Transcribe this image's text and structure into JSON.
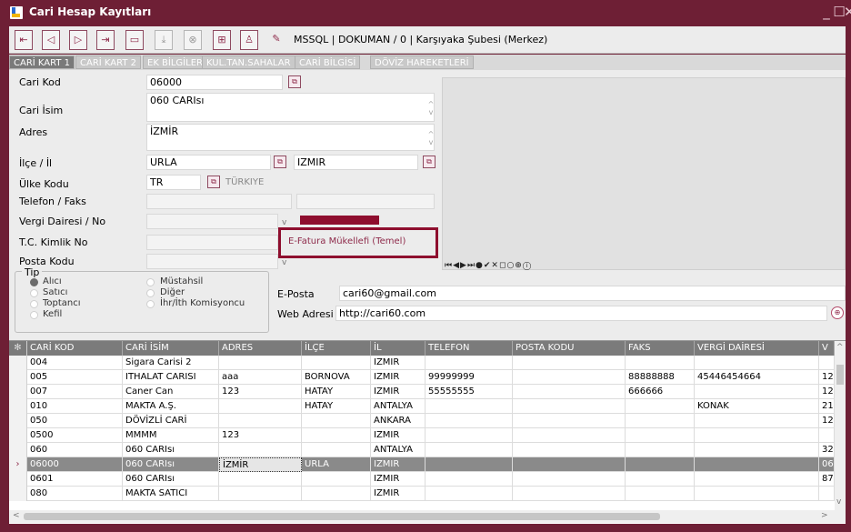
{
  "window": {
    "title": "Cari Hesap Kayıtları"
  },
  "toolbar": {
    "buttons": [
      "first-record",
      "prev-record",
      "next-record",
      "last-record",
      "new-record",
      "save",
      "cancel",
      "add",
      "user",
      "edit"
    ],
    "db_info": "MSSQL | DOKUMAN / 0 | Karşıyaka Şubesi (Merkez)"
  },
  "tabs": [
    "CARİ KART 1",
    "CARİ KART 2",
    "EK BİLGİLER",
    "KUL.TAN.SAHALAR",
    "CARİ BİLGİSİ",
    "DÖVİZ HAREKETLERİ"
  ],
  "form": {
    "cari_kod_label": "Cari Kod",
    "cari_kod": "06000",
    "cari_isim_label": "Cari İsim",
    "cari_isim": "060 CARIsı",
    "adres_label": "Adres",
    "adres": "İZMİR",
    "ilce_il_label": "İlçe / İl",
    "ilce": "URLA",
    "il": "IZMIR",
    "ulke_label": "Ülke Kodu",
    "ulke_kodu": "TR",
    "ulke_adi": "TÜRKIYE",
    "telefon_label": "Telefon / Faks",
    "vergi_label": "Vergi Dairesi / No",
    "tc_label": "T.C. Kimlik No",
    "posta_label": "Posta Kodu",
    "efatura_option": "E-Fatura Mükellefi (Temel)"
  },
  "tip": {
    "title": "Tip",
    "options_left": [
      "Alıcı",
      "Satıcı",
      "Toptancı",
      "Kefil"
    ],
    "options_right": [
      "Müstahsil",
      "Diğer",
      "İhr/İth Komisyoncu"
    ],
    "selected": "Alıcı"
  },
  "contact": {
    "email_label": "E-Posta",
    "email": "cari60@gmail.com",
    "web_label": "Web Adresi",
    "web": "http://cari60.com"
  },
  "grid": {
    "columns": [
      "CARİ KOD",
      "CARİ İSİM",
      "ADRES",
      "İLÇE",
      "İL",
      "TELEFON",
      "POSTA KODU",
      "FAKS",
      "VERGİ DAİRESİ",
      "V"
    ],
    "rows": [
      [
        "004",
        "Sigara Carisi 2",
        "",
        "",
        "IZMIR",
        "",
        "",
        "",
        "",
        ""
      ],
      [
        "005",
        "ITHALAT CARISI",
        "aaa",
        "BORNOVA",
        "IZMIR",
        "99999999",
        "",
        "88888888",
        "45446454664",
        "12"
      ],
      [
        "007",
        "Caner Can",
        "123",
        "HATAY",
        "IZMIR",
        "55555555",
        "",
        "666666",
        "",
        "12"
      ],
      [
        "010",
        "MAKTA A.Ş.",
        "",
        "HATAY",
        "ANTALYA",
        "",
        "",
        "",
        "KONAK",
        "21"
      ],
      [
        "050",
        "DÖVİZLİ CARİ",
        "",
        "",
        "ANKARA",
        "",
        "",
        "",
        "",
        "12"
      ],
      [
        "0500",
        "MMMM",
        "123",
        "",
        "IZMIR",
        "",
        "",
        "",
        "",
        ""
      ],
      [
        "060",
        "060 CARIsı",
        "",
        "",
        "ANTALYA",
        "",
        "",
        "",
        "",
        "32"
      ],
      [
        "06000",
        "060 CARIsı",
        "İZMİR",
        "URLA",
        "IZMIR",
        "",
        "",
        "",
        "",
        "06"
      ],
      [
        "0601",
        "060 CARIsı",
        "",
        "",
        "IZMIR",
        "",
        "",
        "",
        "",
        "87"
      ],
      [
        "080",
        "MAKTA SATICI",
        "",
        "",
        "IZMIR",
        "",
        "",
        "",
        "",
        ""
      ]
    ],
    "selected_row": 7
  }
}
